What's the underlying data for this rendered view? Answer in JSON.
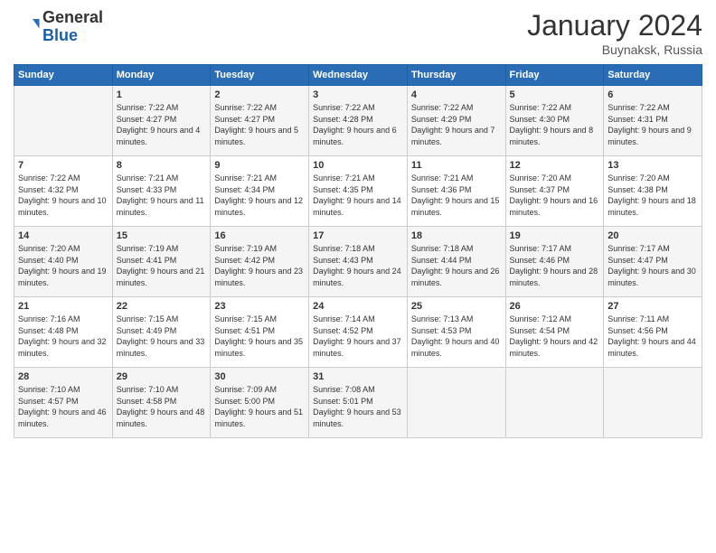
{
  "header": {
    "logo": {
      "line1": "General",
      "line2": "Blue"
    },
    "title": "January 2024",
    "subtitle": "Buynaksk, Russia"
  },
  "weekdays": [
    "Sunday",
    "Monday",
    "Tuesday",
    "Wednesday",
    "Thursday",
    "Friday",
    "Saturday"
  ],
  "weeks": [
    [
      {
        "day": "",
        "sunrise": "",
        "sunset": "",
        "daylight": ""
      },
      {
        "day": "1",
        "sunrise": "Sunrise: 7:22 AM",
        "sunset": "Sunset: 4:27 PM",
        "daylight": "Daylight: 9 hours and 4 minutes."
      },
      {
        "day": "2",
        "sunrise": "Sunrise: 7:22 AM",
        "sunset": "Sunset: 4:27 PM",
        "daylight": "Daylight: 9 hours and 5 minutes."
      },
      {
        "day": "3",
        "sunrise": "Sunrise: 7:22 AM",
        "sunset": "Sunset: 4:28 PM",
        "daylight": "Daylight: 9 hours and 6 minutes."
      },
      {
        "day": "4",
        "sunrise": "Sunrise: 7:22 AM",
        "sunset": "Sunset: 4:29 PM",
        "daylight": "Daylight: 9 hours and 7 minutes."
      },
      {
        "day": "5",
        "sunrise": "Sunrise: 7:22 AM",
        "sunset": "Sunset: 4:30 PM",
        "daylight": "Daylight: 9 hours and 8 minutes."
      },
      {
        "day": "6",
        "sunrise": "Sunrise: 7:22 AM",
        "sunset": "Sunset: 4:31 PM",
        "daylight": "Daylight: 9 hours and 9 minutes."
      }
    ],
    [
      {
        "day": "7",
        "sunrise": "Sunrise: 7:22 AM",
        "sunset": "Sunset: 4:32 PM",
        "daylight": "Daylight: 9 hours and 10 minutes."
      },
      {
        "day": "8",
        "sunrise": "Sunrise: 7:21 AM",
        "sunset": "Sunset: 4:33 PM",
        "daylight": "Daylight: 9 hours and 11 minutes."
      },
      {
        "day": "9",
        "sunrise": "Sunrise: 7:21 AM",
        "sunset": "Sunset: 4:34 PM",
        "daylight": "Daylight: 9 hours and 12 minutes."
      },
      {
        "day": "10",
        "sunrise": "Sunrise: 7:21 AM",
        "sunset": "Sunset: 4:35 PM",
        "daylight": "Daylight: 9 hours and 14 minutes."
      },
      {
        "day": "11",
        "sunrise": "Sunrise: 7:21 AM",
        "sunset": "Sunset: 4:36 PM",
        "daylight": "Daylight: 9 hours and 15 minutes."
      },
      {
        "day": "12",
        "sunrise": "Sunrise: 7:20 AM",
        "sunset": "Sunset: 4:37 PM",
        "daylight": "Daylight: 9 hours and 16 minutes."
      },
      {
        "day": "13",
        "sunrise": "Sunrise: 7:20 AM",
        "sunset": "Sunset: 4:38 PM",
        "daylight": "Daylight: 9 hours and 18 minutes."
      }
    ],
    [
      {
        "day": "14",
        "sunrise": "Sunrise: 7:20 AM",
        "sunset": "Sunset: 4:40 PM",
        "daylight": "Daylight: 9 hours and 19 minutes."
      },
      {
        "day": "15",
        "sunrise": "Sunrise: 7:19 AM",
        "sunset": "Sunset: 4:41 PM",
        "daylight": "Daylight: 9 hours and 21 minutes."
      },
      {
        "day": "16",
        "sunrise": "Sunrise: 7:19 AM",
        "sunset": "Sunset: 4:42 PM",
        "daylight": "Daylight: 9 hours and 23 minutes."
      },
      {
        "day": "17",
        "sunrise": "Sunrise: 7:18 AM",
        "sunset": "Sunset: 4:43 PM",
        "daylight": "Daylight: 9 hours and 24 minutes."
      },
      {
        "day": "18",
        "sunrise": "Sunrise: 7:18 AM",
        "sunset": "Sunset: 4:44 PM",
        "daylight": "Daylight: 9 hours and 26 minutes."
      },
      {
        "day": "19",
        "sunrise": "Sunrise: 7:17 AM",
        "sunset": "Sunset: 4:46 PM",
        "daylight": "Daylight: 9 hours and 28 minutes."
      },
      {
        "day": "20",
        "sunrise": "Sunrise: 7:17 AM",
        "sunset": "Sunset: 4:47 PM",
        "daylight": "Daylight: 9 hours and 30 minutes."
      }
    ],
    [
      {
        "day": "21",
        "sunrise": "Sunrise: 7:16 AM",
        "sunset": "Sunset: 4:48 PM",
        "daylight": "Daylight: 9 hours and 32 minutes."
      },
      {
        "day": "22",
        "sunrise": "Sunrise: 7:15 AM",
        "sunset": "Sunset: 4:49 PM",
        "daylight": "Daylight: 9 hours and 33 minutes."
      },
      {
        "day": "23",
        "sunrise": "Sunrise: 7:15 AM",
        "sunset": "Sunset: 4:51 PM",
        "daylight": "Daylight: 9 hours and 35 minutes."
      },
      {
        "day": "24",
        "sunrise": "Sunrise: 7:14 AM",
        "sunset": "Sunset: 4:52 PM",
        "daylight": "Daylight: 9 hours and 37 minutes."
      },
      {
        "day": "25",
        "sunrise": "Sunrise: 7:13 AM",
        "sunset": "Sunset: 4:53 PM",
        "daylight": "Daylight: 9 hours and 40 minutes."
      },
      {
        "day": "26",
        "sunrise": "Sunrise: 7:12 AM",
        "sunset": "Sunset: 4:54 PM",
        "daylight": "Daylight: 9 hours and 42 minutes."
      },
      {
        "day": "27",
        "sunrise": "Sunrise: 7:11 AM",
        "sunset": "Sunset: 4:56 PM",
        "daylight": "Daylight: 9 hours and 44 minutes."
      }
    ],
    [
      {
        "day": "28",
        "sunrise": "Sunrise: 7:10 AM",
        "sunset": "Sunset: 4:57 PM",
        "daylight": "Daylight: 9 hours and 46 minutes."
      },
      {
        "day": "29",
        "sunrise": "Sunrise: 7:10 AM",
        "sunset": "Sunset: 4:58 PM",
        "daylight": "Daylight: 9 hours and 48 minutes."
      },
      {
        "day": "30",
        "sunrise": "Sunrise: 7:09 AM",
        "sunset": "Sunset: 5:00 PM",
        "daylight": "Daylight: 9 hours and 51 minutes."
      },
      {
        "day": "31",
        "sunrise": "Sunrise: 7:08 AM",
        "sunset": "Sunset: 5:01 PM",
        "daylight": "Daylight: 9 hours and 53 minutes."
      },
      {
        "day": "",
        "sunrise": "",
        "sunset": "",
        "daylight": ""
      },
      {
        "day": "",
        "sunrise": "",
        "sunset": "",
        "daylight": ""
      },
      {
        "day": "",
        "sunrise": "",
        "sunset": "",
        "daylight": ""
      }
    ]
  ]
}
